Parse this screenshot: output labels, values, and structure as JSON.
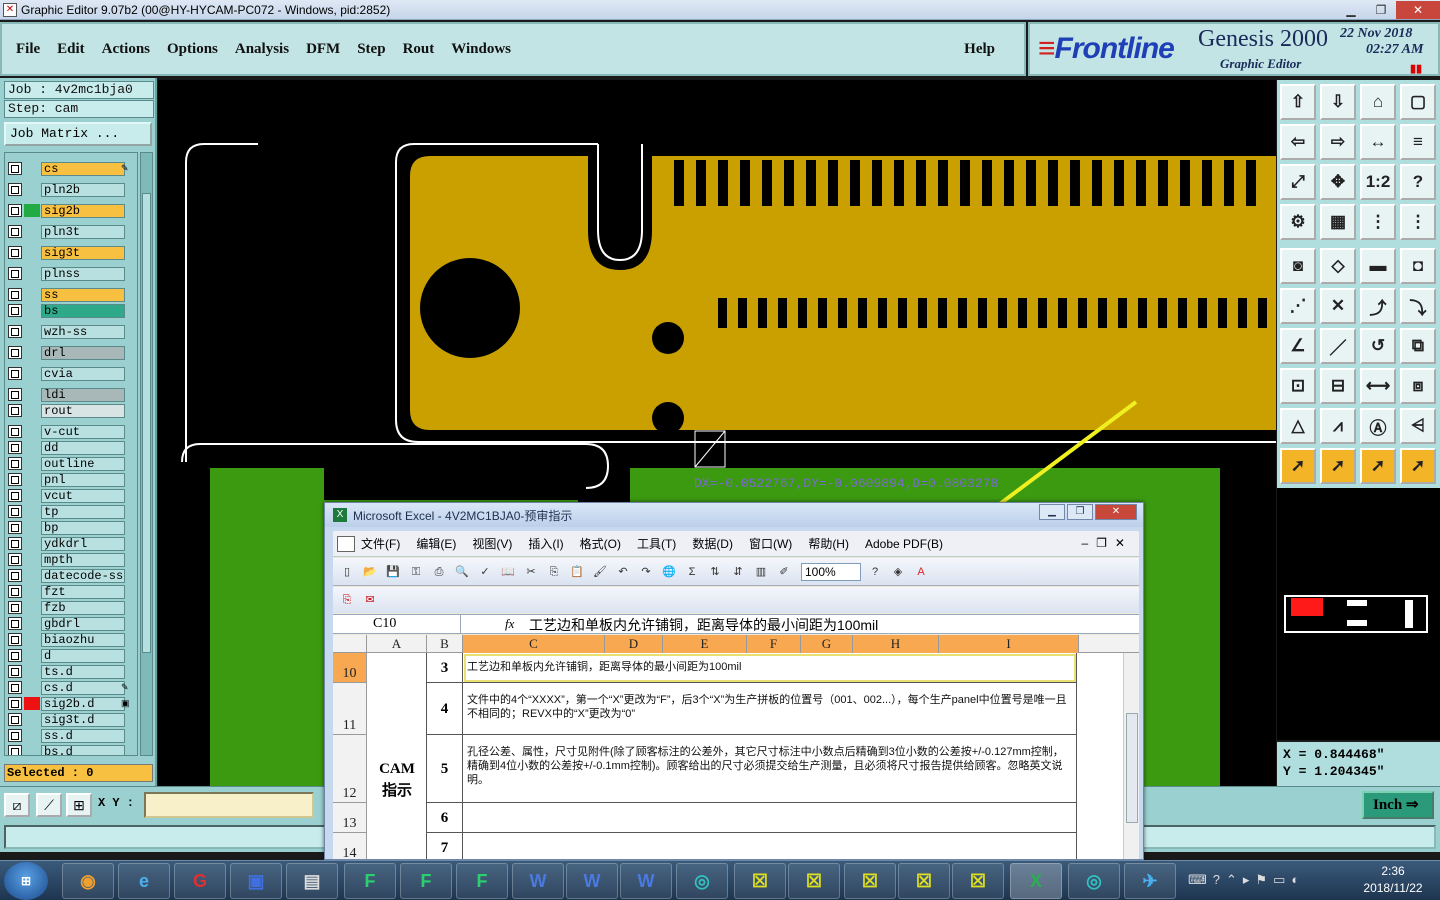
{
  "window": {
    "title": "Graphic Editor 9.07b2 (00@HY-HYCAM-PC072 - Windows, pid:2852)"
  },
  "menu": [
    {
      "label": "File"
    },
    {
      "label": "Edit"
    },
    {
      "label": "Actions"
    },
    {
      "label": "Options"
    },
    {
      "label": "Analysis"
    },
    {
      "label": "DFM"
    },
    {
      "label": "Step"
    },
    {
      "label": "Rout"
    },
    {
      "label": "Windows"
    }
  ],
  "help_label": "Help",
  "logo": {
    "brand": "Frontline",
    "product": "Genesis 2000",
    "subtitle": "Graphic Editor",
    "date": "22  Nov  2018",
    "time": "02:27  AM"
  },
  "job": {
    "job_label": "Job  :  4v2mc1bja0",
    "step_label": "Step:  cam",
    "matrix_button": "Job Matrix ..."
  },
  "layers": [
    {
      "name": "cs",
      "style": "hl",
      "swatch": "",
      "mark": "✎"
    },
    {
      "name": "pln2b",
      "style": "",
      "swatch": "",
      "mark": ""
    },
    {
      "name": "sig2b",
      "style": "hl",
      "swatch": "#22aa44",
      "mark": ""
    },
    {
      "name": "pln3t",
      "style": "",
      "swatch": "",
      "mark": ""
    },
    {
      "name": "sig3t",
      "style": "hl",
      "swatch": "",
      "mark": ""
    },
    {
      "name": "plnss",
      "style": "",
      "swatch": "",
      "mark": ""
    },
    {
      "name": "ss",
      "style": "hl",
      "swatch": "",
      "mark": ""
    },
    {
      "name": "bs",
      "style": "teal",
      "swatch": "",
      "mark": ""
    },
    {
      "name": "wzh-ss",
      "style": "",
      "swatch": "",
      "mark": ""
    },
    {
      "name": "drl",
      "style": "grey",
      "swatch": "",
      "mark": ""
    },
    {
      "name": "cvia",
      "style": "",
      "swatch": "",
      "mark": ""
    },
    {
      "name": "ldi",
      "style": "grey",
      "swatch": "",
      "mark": ""
    },
    {
      "name": "rout",
      "style": "wh",
      "swatch": "",
      "mark": ""
    },
    {
      "name": "v-cut",
      "style": "",
      "swatch": "",
      "mark": ""
    },
    {
      "name": "dd",
      "style": "",
      "swatch": "",
      "mark": ""
    },
    {
      "name": "outline",
      "style": "",
      "swatch": "",
      "mark": ""
    },
    {
      "name": "pnl",
      "style": "",
      "swatch": "",
      "mark": ""
    },
    {
      "name": "vcut",
      "style": "",
      "swatch": "",
      "mark": ""
    },
    {
      "name": "tp",
      "style": "",
      "swatch": "",
      "mark": ""
    },
    {
      "name": "bp",
      "style": "",
      "swatch": "",
      "mark": ""
    },
    {
      "name": "ydkdrl",
      "style": "",
      "swatch": "",
      "mark": ""
    },
    {
      "name": "mpth",
      "style": "",
      "swatch": "",
      "mark": ""
    },
    {
      "name": "datecode-ss",
      "style": "",
      "swatch": "",
      "mark": ""
    },
    {
      "name": "fzt",
      "style": "",
      "swatch": "",
      "mark": ""
    },
    {
      "name": "fzb",
      "style": "",
      "swatch": "",
      "mark": ""
    },
    {
      "name": "gbdrl",
      "style": "",
      "swatch": "",
      "mark": ""
    },
    {
      "name": "biaozhu",
      "style": "",
      "swatch": "",
      "mark": ""
    },
    {
      "name": "d",
      "style": "",
      "swatch": "",
      "mark": ""
    },
    {
      "name": "ts.d",
      "style": "",
      "swatch": "",
      "mark": ""
    },
    {
      "name": "cs.d",
      "style": "",
      "swatch": "",
      "mark": "✎"
    },
    {
      "name": "sig2b.d",
      "style": "",
      "swatch": "#ee1111",
      "mark": "▣"
    },
    {
      "name": "sig3t.d",
      "style": "",
      "swatch": "",
      "mark": ""
    },
    {
      "name": "ss.d",
      "style": "",
      "swatch": "",
      "mark": ""
    },
    {
      "name": "bs.d",
      "style": "",
      "swatch": "",
      "mark": ""
    }
  ],
  "selected_label": "Selected : 0",
  "measure_text": "DX=-0.0522767,DY=-0.0609894,D=0.0803278",
  "coords": {
    "x": "X = 0.844468\"",
    "y": "Y = 1.204345\""
  },
  "bottom": {
    "xy_label": "X Y :",
    "xy_value": "",
    "units": "Inch"
  },
  "excel": {
    "title": "Microsoft Excel - 4V2MC1BJA0-预审指示",
    "menu": [
      "文件(F)",
      "编辑(E)",
      "视图(V)",
      "插入(I)",
      "格式(O)",
      "工具(T)",
      "数据(D)",
      "窗口(W)",
      "帮助(H)",
      "Adobe PDF(B)"
    ],
    "zoom": "100%",
    "namebox": "C10",
    "fx": "fx",
    "formula": "工艺边和单板内允许铺铜，距离导体的最小间距为100mil",
    "columns": [
      "A",
      "B",
      "C",
      "D",
      "E",
      "F",
      "G",
      "H",
      "I"
    ],
    "cam_label_1": "CAM",
    "cam_label_2": "指示",
    "rows": [
      {
        "rownum": "10",
        "b": "3",
        "c": "工艺边和单板内允许铺铜，距离导体的最小间距为100mil"
      },
      {
        "rownum": "11",
        "b": "4",
        "c": "文件中的4个“XXXX”，第一个“X”更改为“F”，后3个“X”为生产拼板的位置号（001、002...），每个生产panel中位置号是唯一且不相同的；REVX中的“X”更改为“0”"
      },
      {
        "rownum": "12",
        "b": "5",
        "c": "孔径公差、属性，尺寸见附件(除了顾客标注的公差外，其它尺寸标注中小数点后精确到3位小数的公差按+/-0.127mm控制，精确到4位小数的公差按+/-0.1mm控制)。顾客给出的尺寸必须提交给生产测量，且必须将尺寸报告提供给顾客。忽略英文说明。"
      },
      {
        "rownum": "13",
        "b": "6",
        "c": ""
      },
      {
        "rownum": "14",
        "b": "7",
        "c": ""
      }
    ]
  },
  "taskbar": {
    "time": "2:36",
    "date": "2018/11/22"
  },
  "colors": {
    "copper": "#c9a000",
    "green": "#3c9a10",
    "panel": "#9ad0d0",
    "highlight": "#f8c040"
  }
}
